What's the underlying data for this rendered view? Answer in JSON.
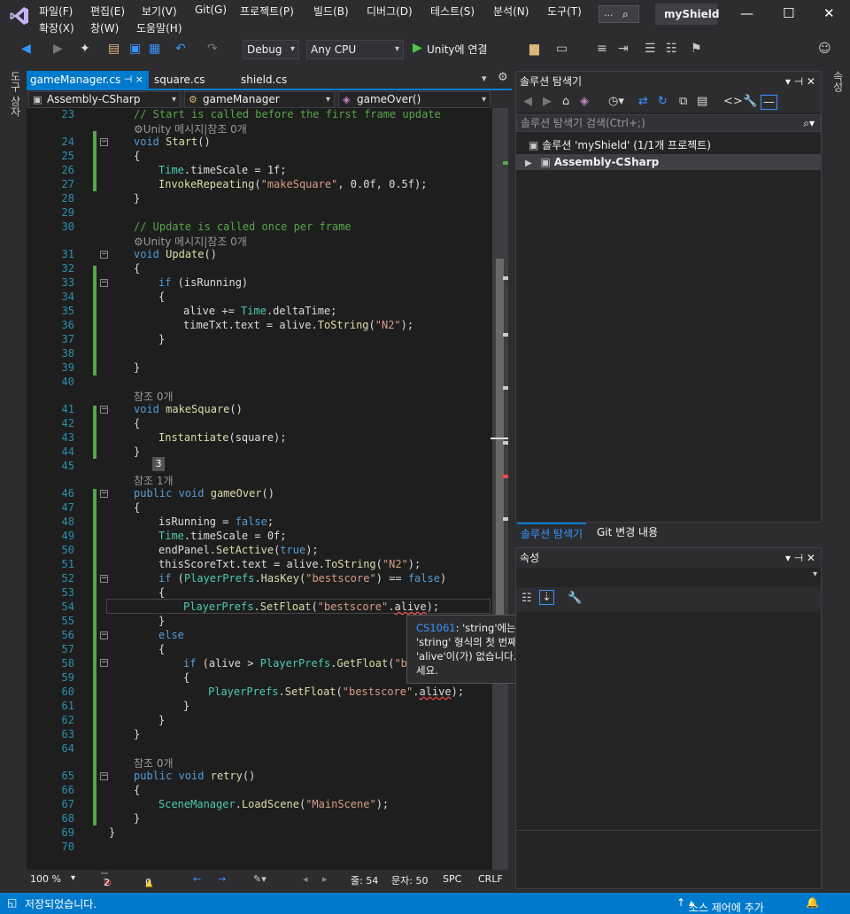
{
  "menu": [
    "파일(F)",
    "편집(E)",
    "보기(V)",
    "Git(G)",
    "프로젝트(P)",
    "빌드(B)",
    "디버그(D)",
    "테스트(S)",
    "분석(N)",
    "도구(T)",
    "확장(X)",
    "창(W)",
    "도움말(H)"
  ],
  "search": {
    "dots": "..."
  },
  "project_title": "myShield",
  "toolbar": {
    "config": "Debug",
    "platform": "Any CPU",
    "run": "Unity에 연결"
  },
  "left_strip": "도구 상자",
  "right_strip": "속성",
  "tabs": [
    {
      "label": "gameManager.cs",
      "pin": "⊣ ×"
    },
    {
      "label": "square.cs"
    },
    {
      "label": "shield.cs"
    }
  ],
  "nav": {
    "assembly": "Assembly-CSharp",
    "class": "gameManager",
    "member": "gameOver()"
  },
  "code": {
    "l23": "// Start is called before the first frame update",
    "lens23": "Unity 메시지|참조 0개",
    "l24a": "void",
    "l24b": "Start",
    "l24c": "()",
    "l25": "{",
    "l26a": "Time",
    "l26b": ".timeScale = 1f;",
    "l27a": "InvokeRepeating",
    "l27b": "(",
    "l27c": "\"makeSquare\"",
    "l27d": ", 0.0f, 0.5f);",
    "l28": "}",
    "l30": "// Update is called once per frame",
    "lens30": "Unity 메시지|참조 0개",
    "l31a": "void",
    "l31b": "Update",
    "l31c": "()",
    "l32": "{",
    "l33a": "if",
    "l33b": " (isRunning)",
    "l34": "{",
    "l35a": "alive += ",
    "l35b": "Time",
    "l35c": ".deltaTime;",
    "l36a": "timeTxt.text = alive.",
    "l36b": "ToString",
    "l36c": "(",
    "l36d": "\"N2\"",
    "l36e": ");",
    "l37": "}",
    "l39": "}",
    "lens40": "참조 0개",
    "l41a": "void",
    "l41b": "makeSquare",
    "l41c": "()",
    "l42": "{",
    "l43a": "Instantiate",
    "l43b": "(square);",
    "l44": "}",
    "l45badge": "3",
    "lens45": "참조 1개",
    "l46a": "public",
    "l46b": "void",
    "l46c": "gameOver",
    "l46d": "()",
    "l47": "{",
    "l48a": "isRunning = ",
    "l48b": "false",
    "l48c": ";",
    "l49a": "Time",
    "l49b": ".timeScale = 0f;",
    "l50a": "endPanel.",
    "l50b": "SetActive",
    "l50c": "(",
    "l50d": "true",
    "l50e": ");",
    "l51a": "thisScoreTxt.text = alive.",
    "l51b": "ToString",
    "l51c": "(",
    "l51d": "\"N2\"",
    "l51e": ");",
    "l52a": "if",
    "l52b": " (",
    "l52c": "PlayerPrefs",
    "l52d": ".",
    "l52e": "HasKey",
    "l52f": "(",
    "l52g": "\"bestscore\"",
    "l52h": ") == ",
    "l52i": "false",
    "l52j": ")",
    "l53": "{",
    "l54a": "PlayerPrefs",
    "l54b": ".",
    "l54c": "SetFloat",
    "l54d": "(",
    "l54e": "\"bestscore\"",
    "l54f": ".",
    "l54g": "alive",
    "l54h": ");",
    "l55": "}",
    "l56": "else",
    "l57": "{",
    "l58a": "if",
    "l58b": " (alive > ",
    "l58c": "PlayerPrefs",
    "l58d": ".",
    "l58e": "GetFloat",
    "l58f": "(",
    "l58g": "\"be",
    "l59": "{",
    "l60a": "PlayerPrefs",
    "l60b": ".",
    "l60c": "SetFloat",
    "l60d": "(",
    "l60e": "\"bestscore\"",
    "l60f": ".",
    "l60g": "alive",
    "l60h": ");",
    "l61": "}",
    "l62": "}",
    "l63": "}",
    "lens64": "참조 0개",
    "l65a": "public",
    "l65b": "void",
    "l65c": "retry",
    "l65d": "()",
    "l66": "{",
    "l67a": "SceneManager",
    "l67b": ".",
    "l67c": "LoadScene",
    "l67d": "(",
    "l67e": "\"MainScene\"",
    "l67f": ");",
    "l68": "}",
    "l69": "}"
  },
  "line_numbers": [
    "23",
    "24",
    "25",
    "26",
    "27",
    "28",
    "29",
    "30",
    "31",
    "32",
    "33",
    "34",
    "35",
    "36",
    "37",
    "38",
    "39",
    "40",
    "41",
    "42",
    "43",
    "44",
    "45",
    "46",
    "47",
    "48",
    "49",
    "50",
    "51",
    "52",
    "53",
    "54",
    "55",
    "56",
    "57",
    "58",
    "59",
    "60",
    "61",
    "62",
    "63",
    "64",
    "65",
    "66",
    "67",
    "68",
    "69",
    "70"
  ],
  "tooltip": {
    "code": "CS1061",
    "text": ": 'string'에는 'alive'에 대한 정의가 포함되어 있지 않고, 'string' 형식의 첫 번째 인수를 허용하는 액세스 가능한 확장 메서드 'alive'이(가) 없습니다. using 지시문 또는 어셈블리 참조가 있는지 확인하세요."
  },
  "editor_status": {
    "zoom": "100 %",
    "errors": "2",
    "warnings": "0",
    "line": "줄: 54",
    "col": "문자: 50",
    "spc": "SPC",
    "crlf": "CRLF"
  },
  "solution_explorer": {
    "title": "솔루션 탐색기",
    "search_placeholder": "솔루션 탐색기 검색(Ctrl+;)",
    "solution": "솔루션 'myShield' (1/1개 프로젝트)",
    "project": "Assembly-CSharp"
  },
  "panel_tabs": [
    "솔루션 탐색기",
    "Git 변경 내용"
  ],
  "properties": {
    "title": "속성"
  },
  "status": {
    "saved": "저장되었습니다.",
    "source_control": "소스 제어에 추가"
  }
}
